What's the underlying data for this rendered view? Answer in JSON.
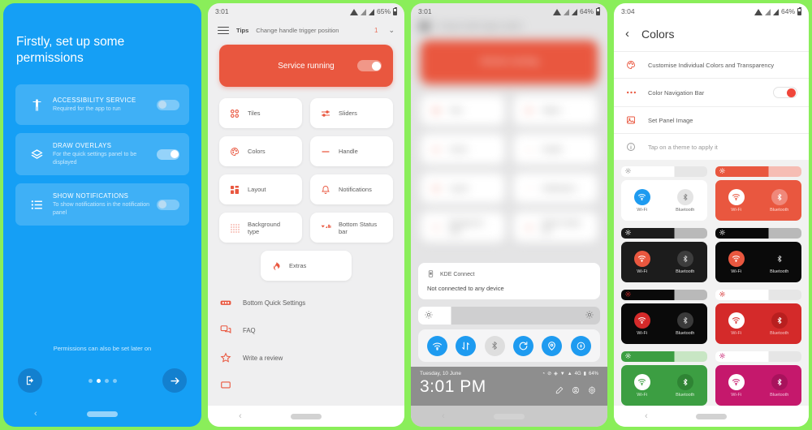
{
  "theme_colors": {
    "frame_green": "#8aee5a",
    "accent_blue": "#159ff5",
    "accent_red": "#e9573f",
    "qs_blue": "#1e9bf0"
  },
  "panel1": {
    "name": "permissions-onboarding",
    "title": "Firstly, set up some permissions",
    "permissions": [
      {
        "icon": "accessibility-icon",
        "title": "ACCESSIBILITY SERVICE",
        "subtitle": "Required for the app to run",
        "enabled": false
      },
      {
        "icon": "layers-icon",
        "title": "DRAW OVERLAYS",
        "subtitle": "For the quick settings panel to be displayed",
        "enabled": true
      },
      {
        "icon": "list-icon",
        "title": "SHOW NOTIFICATIONS",
        "subtitle": "To show notifications in the notification panel",
        "enabled": false
      }
    ],
    "note": "Permissions can also be set later on",
    "exit_button": "exit-icon",
    "next_button": "arrow-right-icon",
    "page_dots": 4,
    "active_dot": 2
  },
  "panel2": {
    "name": "main-app-screen",
    "statusbar": {
      "time": "3:01",
      "battery": "65%"
    },
    "tips": {
      "menu_icon": "hamburger-icon",
      "label": "Tips",
      "text": "Change handle trigger position",
      "count": "1",
      "chevron": "chevron-down-icon"
    },
    "service": {
      "label": "Service running",
      "enabled": true
    },
    "grid": [
      {
        "icon": "tiles-icon",
        "label": "Tiles"
      },
      {
        "icon": "sliders-icon",
        "label": "Sliders"
      },
      {
        "icon": "palette-icon",
        "label": "Colors"
      },
      {
        "icon": "handle-icon",
        "label": "Handle"
      },
      {
        "icon": "layout-icon",
        "label": "Layout"
      },
      {
        "icon": "bell-icon",
        "label": "Notifications"
      },
      {
        "icon": "dots-grid-icon",
        "label": "Background type"
      },
      {
        "icon": "status-bar-icon",
        "label": "Bottom Status bar"
      }
    ],
    "extras": {
      "icon": "fire-icon",
      "label": "Extras"
    },
    "list": [
      {
        "icon": "quick-settings-icon",
        "label": "Bottom Quick Settings"
      },
      {
        "icon": "chat-icon",
        "label": "FAQ"
      },
      {
        "icon": "star-icon",
        "label": "Write a review"
      }
    ]
  },
  "panel3": {
    "name": "quick-settings-overlay",
    "statusbar": {
      "time": "3:01",
      "battery": "64%"
    },
    "notification": {
      "icon": "kde-connect-icon",
      "app": "KDE Connect",
      "body": "Not connected to any device"
    },
    "brightness": {
      "left_icon": "brightness-low-icon",
      "right_icon": "brightness-high-icon",
      "value": 18
    },
    "tiles": [
      {
        "icon": "wifi-icon",
        "on": true
      },
      {
        "icon": "mobile-data-icon",
        "on": true
      },
      {
        "icon": "bluetooth-icon",
        "on": false
      },
      {
        "icon": "auto-rotate-icon",
        "on": true
      },
      {
        "icon": "location-icon",
        "on": true
      },
      {
        "icon": "battery-saver-icon",
        "on": true
      }
    ],
    "footer": {
      "date": "Tuesday, 10 June",
      "time": "3:01 PM",
      "battery": "64%",
      "mini_icons": [
        "alarm-icon",
        "dnd-icon",
        "location-icon",
        "wifi-icon",
        "sim-icon",
        "signal-icon",
        "4g-icon",
        "battery-icon"
      ],
      "action_icons": [
        "edit-icon",
        "user-icon",
        "settings-icon"
      ]
    }
  },
  "panel4": {
    "name": "colors-settings-screen",
    "statusbar": {
      "time": "3:04",
      "battery": "64%"
    },
    "header": {
      "back": "back-arrow-icon",
      "title": "Colors"
    },
    "rows": [
      {
        "icon": "palette-icon",
        "label": "Customise Individual Colors and Transparency",
        "toggle": null,
        "muted": false
      },
      {
        "icon": "nav-dots-icon",
        "label": "Color Navigation Bar",
        "toggle": true,
        "muted": false
      },
      {
        "icon": "image-icon",
        "label": "Set Panel Image",
        "toggle": null,
        "muted": false
      },
      {
        "icon": "info-icon",
        "label": "Tap on a theme to apply it",
        "toggle": null,
        "muted": true
      }
    ],
    "theme_labels": {
      "wifi": "Wi-Fi",
      "bluetooth": "Bluetooth"
    },
    "themes": [
      {
        "name": "light-default",
        "bright_track": "#e6e6e6",
        "bright_fill": "#ffffff",
        "bright_icon": "#9a9a9a",
        "body_bg": "#ffffff",
        "wifi_circ": "#1e9bf0",
        "wifi_ico": "#ffffff",
        "bt_circ": "#e4e4e4",
        "bt_ico": "#8b8b8b",
        "label_color": "#6b6b6b"
      },
      {
        "name": "coral",
        "bright_track": "#f6bdb4",
        "bright_fill": "#e9573f",
        "bright_icon": "#ffffff",
        "body_bg": "#e9573f",
        "wifi_circ": "#ffffff",
        "wifi_ico": "#e9573f",
        "bt_circ": "#f0887a",
        "bt_ico": "#ffffff",
        "label_color": "#ffd9d2"
      },
      {
        "name": "dark-coral",
        "bright_track": "#b9b9b9",
        "bright_fill": "#1c1c1c",
        "bright_icon": "#ffffff",
        "body_bg": "#1c1c1c",
        "wifi_circ": "#e9573f",
        "wifi_ico": "#ffffff",
        "bt_circ": "#3d3d3d",
        "bt_ico": "#c9c9c9",
        "label_color": "#e0e0e0"
      },
      {
        "name": "black-coral",
        "bright_track": "#b9b9b9",
        "bright_fill": "#0a0a0a",
        "bright_icon": "#ffffff",
        "body_bg": "#0a0a0a",
        "wifi_circ": "#e9573f",
        "wifi_ico": "#ffffff",
        "bt_circ": "#0a0a0a",
        "bt_ico": "#c9c9c9",
        "label_color": "#e0e0e0"
      },
      {
        "name": "black-red",
        "bright_track": "#b9b9b9",
        "bright_fill": "#0a0a0a",
        "bright_icon": "#d42a2a",
        "body_bg": "#0a0a0a",
        "wifi_circ": "#d42a2a",
        "wifi_ico": "#ffffff",
        "bt_circ": "#3a3a3a",
        "bt_ico": "#c9c9c9",
        "label_color": "#e0e0e0"
      },
      {
        "name": "red",
        "bright_track": "#e6e6e6",
        "bright_fill": "#ffffff",
        "bright_icon": "#d42a2a",
        "body_bg": "#d42a2a",
        "wifi_circ": "#ffffff",
        "wifi_ico": "#d42a2a",
        "bt_circ": "#b81f1f",
        "bt_ico": "#ffffff",
        "label_color": "#f4c4c4"
      },
      {
        "name": "green",
        "bright_track": "#c8e6c4",
        "bright_fill": "#3c9e42",
        "bright_icon": "#ffffff",
        "body_bg": "#3c9e42",
        "wifi_circ": "#ffffff",
        "wifi_ico": "#3c9e42",
        "bt_circ": "#2f8434",
        "bt_ico": "#ffffff",
        "label_color": "#d7efd6"
      },
      {
        "name": "magenta",
        "bright_track": "#e6e6e6",
        "bright_fill": "#ffffff",
        "bright_icon": "#c5186c",
        "body_bg": "#c5186c",
        "wifi_circ": "#ffffff",
        "wifi_ico": "#c5186c",
        "bt_circ": "#a8125c",
        "bt_ico": "#ffffff",
        "label_color": "#f2c2db"
      }
    ]
  }
}
